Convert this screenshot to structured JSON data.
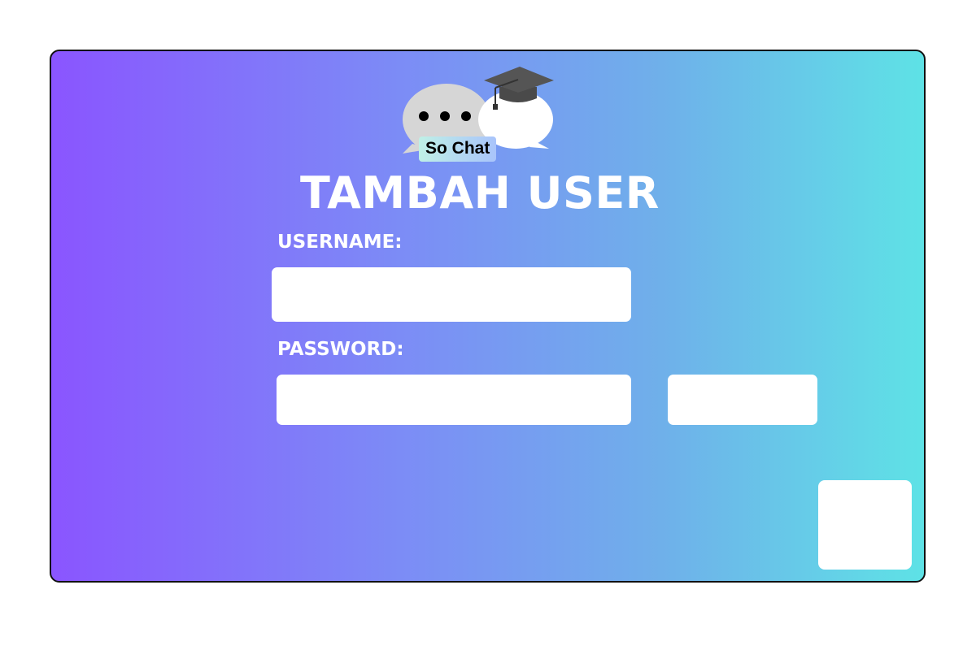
{
  "brand": {
    "name": "So Chat",
    "logo_icon": "chat-bubbles-graduation-cap-icon"
  },
  "form": {
    "title": "TAMBAH USER",
    "username_label": "USERNAME:",
    "username_value": "",
    "password_label": "PASSWORD:",
    "password_value": "",
    "side_button_label": "",
    "corner_button_label": ""
  },
  "colors": {
    "gradient_start": "#8a55ff",
    "gradient_end": "#5ee2e6",
    "text": "#ffffff",
    "field_background": "#ffffff"
  }
}
